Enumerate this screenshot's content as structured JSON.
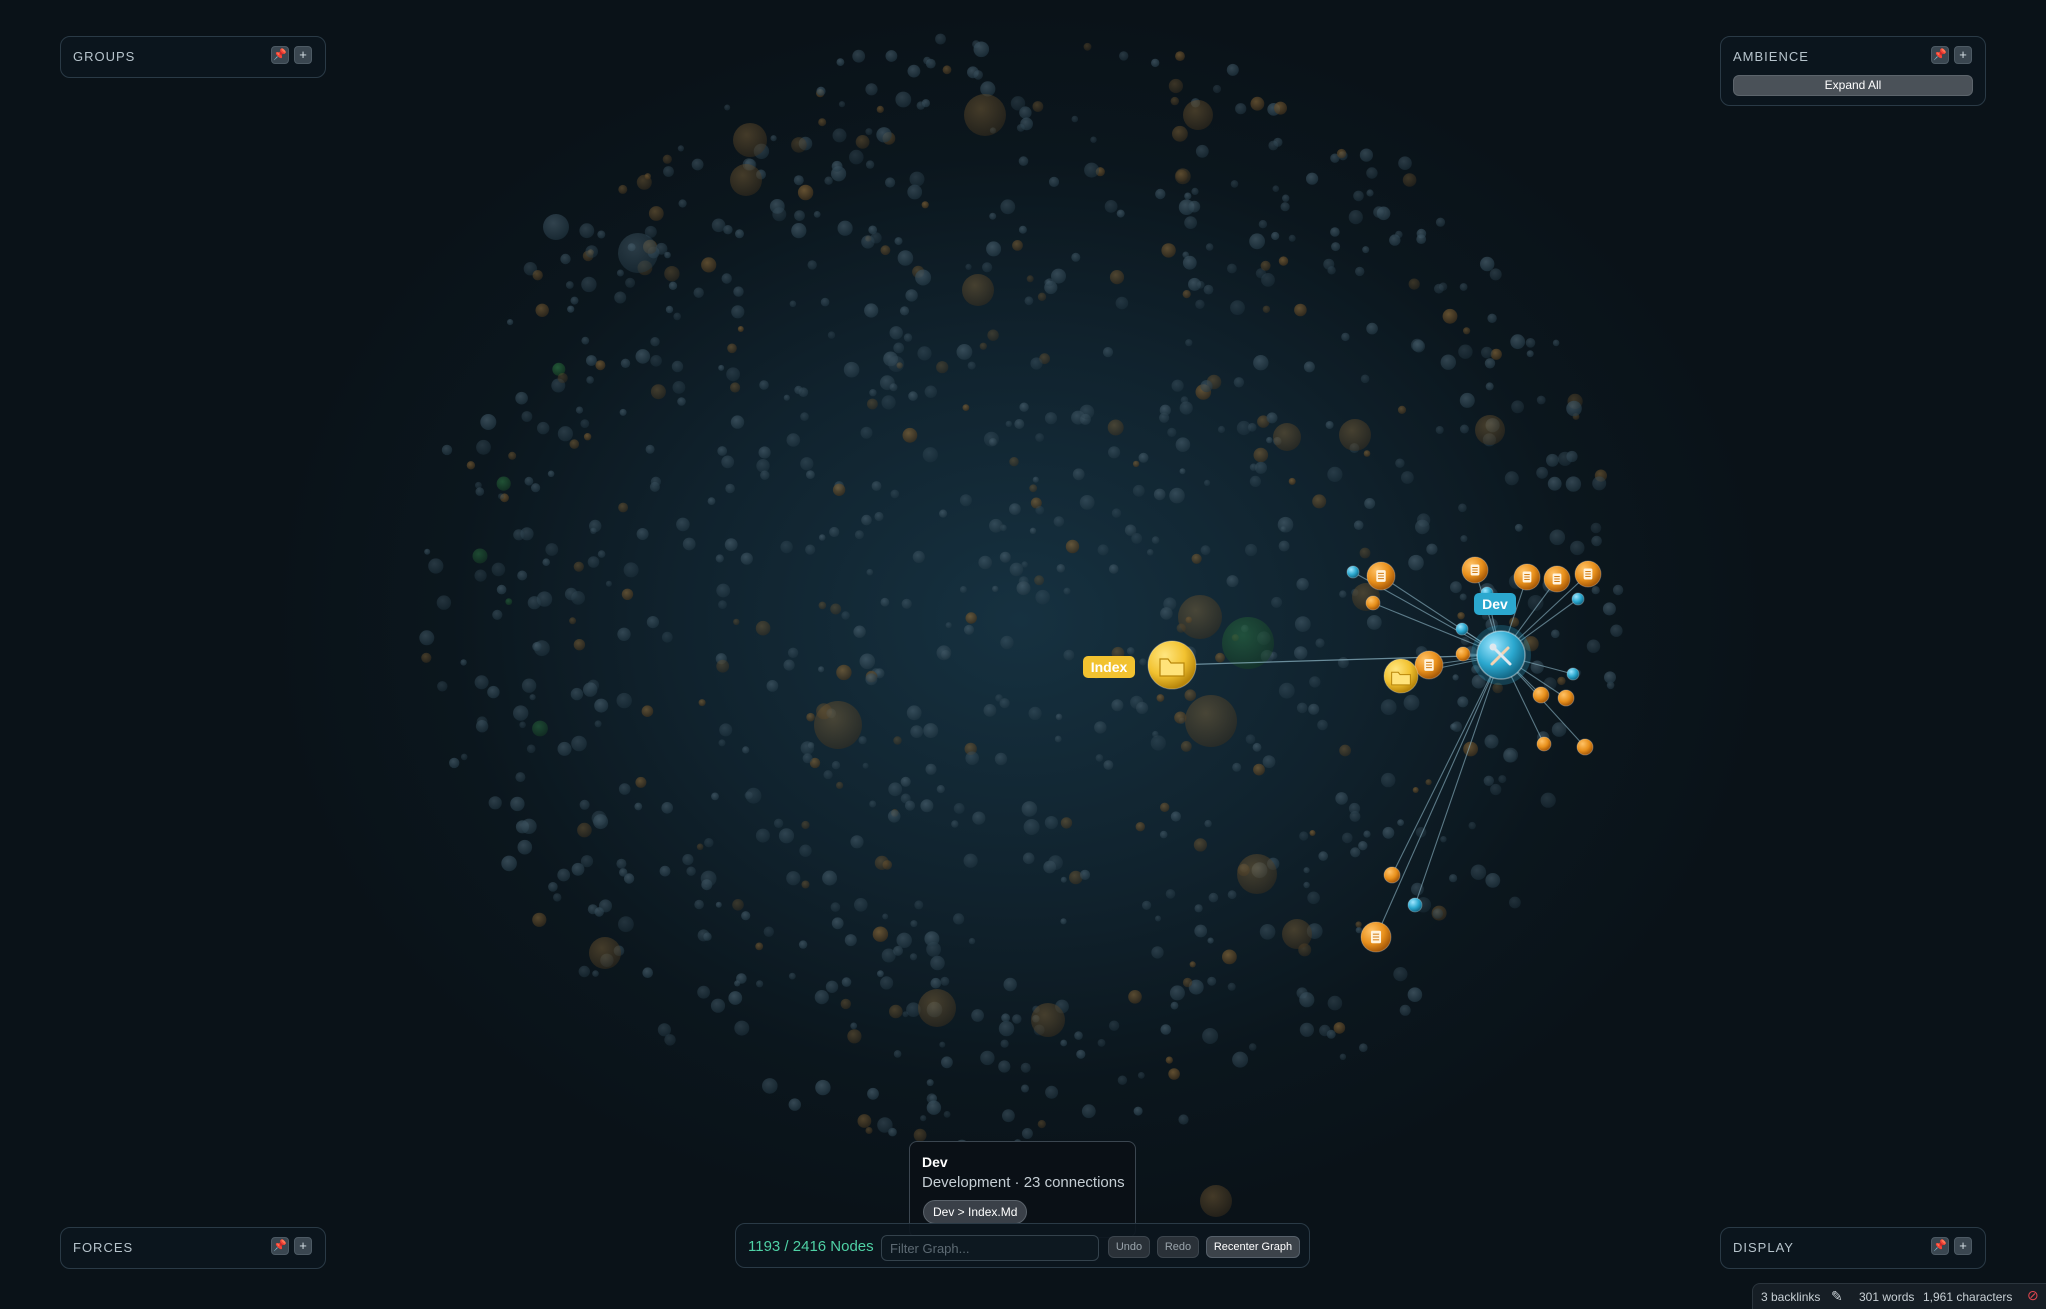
{
  "panels": {
    "groups": {
      "title": "GROUPS",
      "pin_icon": "pin-icon",
      "add_label": "+"
    },
    "ambience": {
      "title": "AMBIENCE",
      "pin_icon": "pin-icon",
      "add_label": "+",
      "expand_label": "Expand All"
    },
    "forces": {
      "title": "FORCES",
      "pin_icon": "pin-icon",
      "add_label": "+"
    },
    "display": {
      "title": "DISPLAY",
      "pin_icon": "pin-icon",
      "add_label": "+"
    }
  },
  "graph": {
    "focus_label": "Dev",
    "index_label": "Index",
    "colors": {
      "folder": "#f2c230",
      "note": "#e8901c",
      "tag": "#3bbfe0",
      "dev": "#2ba8cf",
      "group_green": "#2fa84f"
    },
    "icons": {
      "dev_node": "tools-icon",
      "index_node": "folder-icon",
      "note_node": "document-icon"
    }
  },
  "tooltip": {
    "title": "Dev",
    "subtitle": "Development · 23 connections",
    "path_chip": "Dev > Index.Md"
  },
  "bottombar": {
    "node_count": "1193 / 2416 Nodes",
    "filter_placeholder": "Filter Graph...",
    "undo_label": "Undo",
    "redo_label": "Redo",
    "recenter_label": "Recenter Graph"
  },
  "status": {
    "backlinks": "3 backlinks",
    "edit_icon": "pencil-icon",
    "words": "301 words",
    "characters": "1,961 characters",
    "sync_icon": "sync-off-icon"
  }
}
